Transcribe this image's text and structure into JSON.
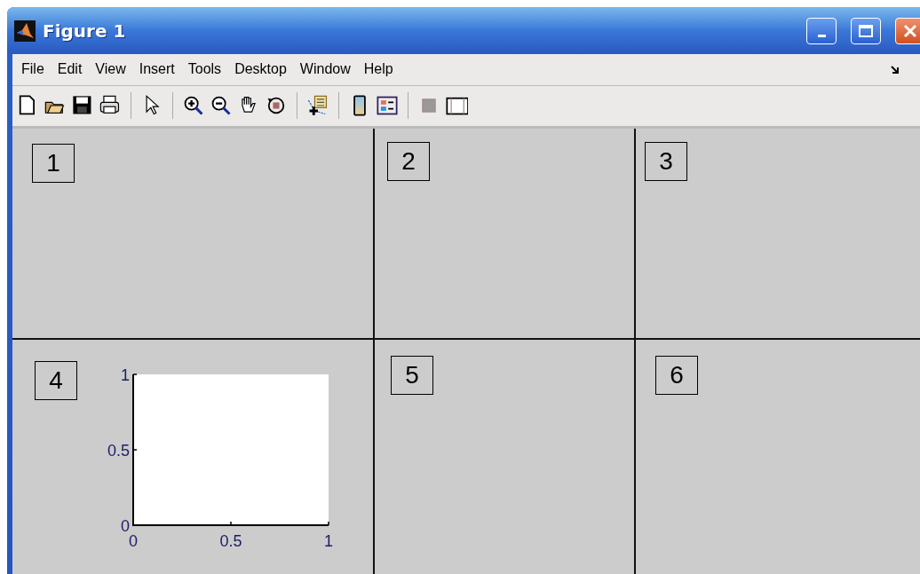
{
  "window": {
    "title": "Figure 1"
  },
  "menu": [
    "File",
    "Edit",
    "View",
    "Insert",
    "Tools",
    "Desktop",
    "Window",
    "Help"
  ],
  "toolbar": [
    {
      "kind": "new"
    },
    {
      "kind": "open"
    },
    {
      "kind": "save"
    },
    {
      "kind": "print"
    },
    {
      "kind": "sep"
    },
    {
      "kind": "pointer"
    },
    {
      "kind": "sep"
    },
    {
      "kind": "zoomin"
    },
    {
      "kind": "zoomout"
    },
    {
      "kind": "pan"
    },
    {
      "kind": "rotate"
    },
    {
      "kind": "sep"
    },
    {
      "kind": "datacursor"
    },
    {
      "kind": "sep"
    },
    {
      "kind": "colorbar"
    },
    {
      "kind": "legend"
    },
    {
      "kind": "sep"
    },
    {
      "kind": "gray"
    },
    {
      "kind": "panel"
    }
  ],
  "panels": [
    {
      "label": "1"
    },
    {
      "label": "2"
    },
    {
      "label": "3"
    },
    {
      "label": "4",
      "chart_data": {
        "type": "line",
        "xlim": [
          0,
          1
        ],
        "ylim": [
          0,
          1
        ],
        "xticks": [
          {
            "value": 0,
            "label": "0"
          },
          {
            "value": 0.5,
            "label": "0.5"
          },
          {
            "value": 1,
            "label": "1"
          }
        ],
        "yticks": [
          {
            "value": 0,
            "label": "0"
          },
          {
            "value": 0.5,
            "label": "0.5"
          },
          {
            "value": 1,
            "label": "1"
          }
        ]
      }
    },
    {
      "label": "5"
    },
    {
      "label": "6"
    }
  ]
}
